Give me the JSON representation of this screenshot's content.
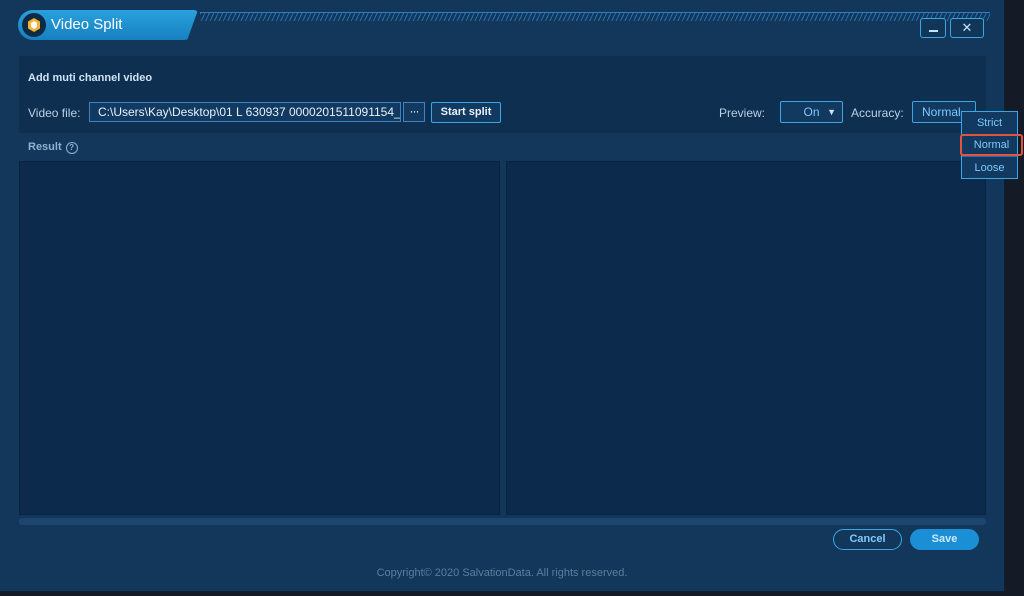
{
  "window": {
    "title": "Video Split",
    "minimize_label": "",
    "close_label": "✕"
  },
  "section": {
    "title": "Add muti channel video"
  },
  "file": {
    "label": "Video file:",
    "value": "C:\\Users\\Kay\\Desktop\\01 L 630937 0000201511091154_",
    "browse_label": "···"
  },
  "actions": {
    "start_split_label": "Start split"
  },
  "preview": {
    "label": "Preview:",
    "value": "On"
  },
  "accuracy": {
    "label": "Accuracy:",
    "value": "Normal",
    "options": [
      "Strict",
      "Normal",
      "Loose"
    ],
    "selected_index": 1
  },
  "result": {
    "label": "Result",
    "help_glyph": "?"
  },
  "footer": {
    "cancel_label": "Cancel",
    "save_label": "Save",
    "copyright": "Copyright© 2020 SalvationData. All rights reserved."
  },
  "colors": {
    "accent": "#1a8fd6",
    "background": "#13375a",
    "panel": "#0f2f51",
    "highlight_border": "#e0553f"
  }
}
